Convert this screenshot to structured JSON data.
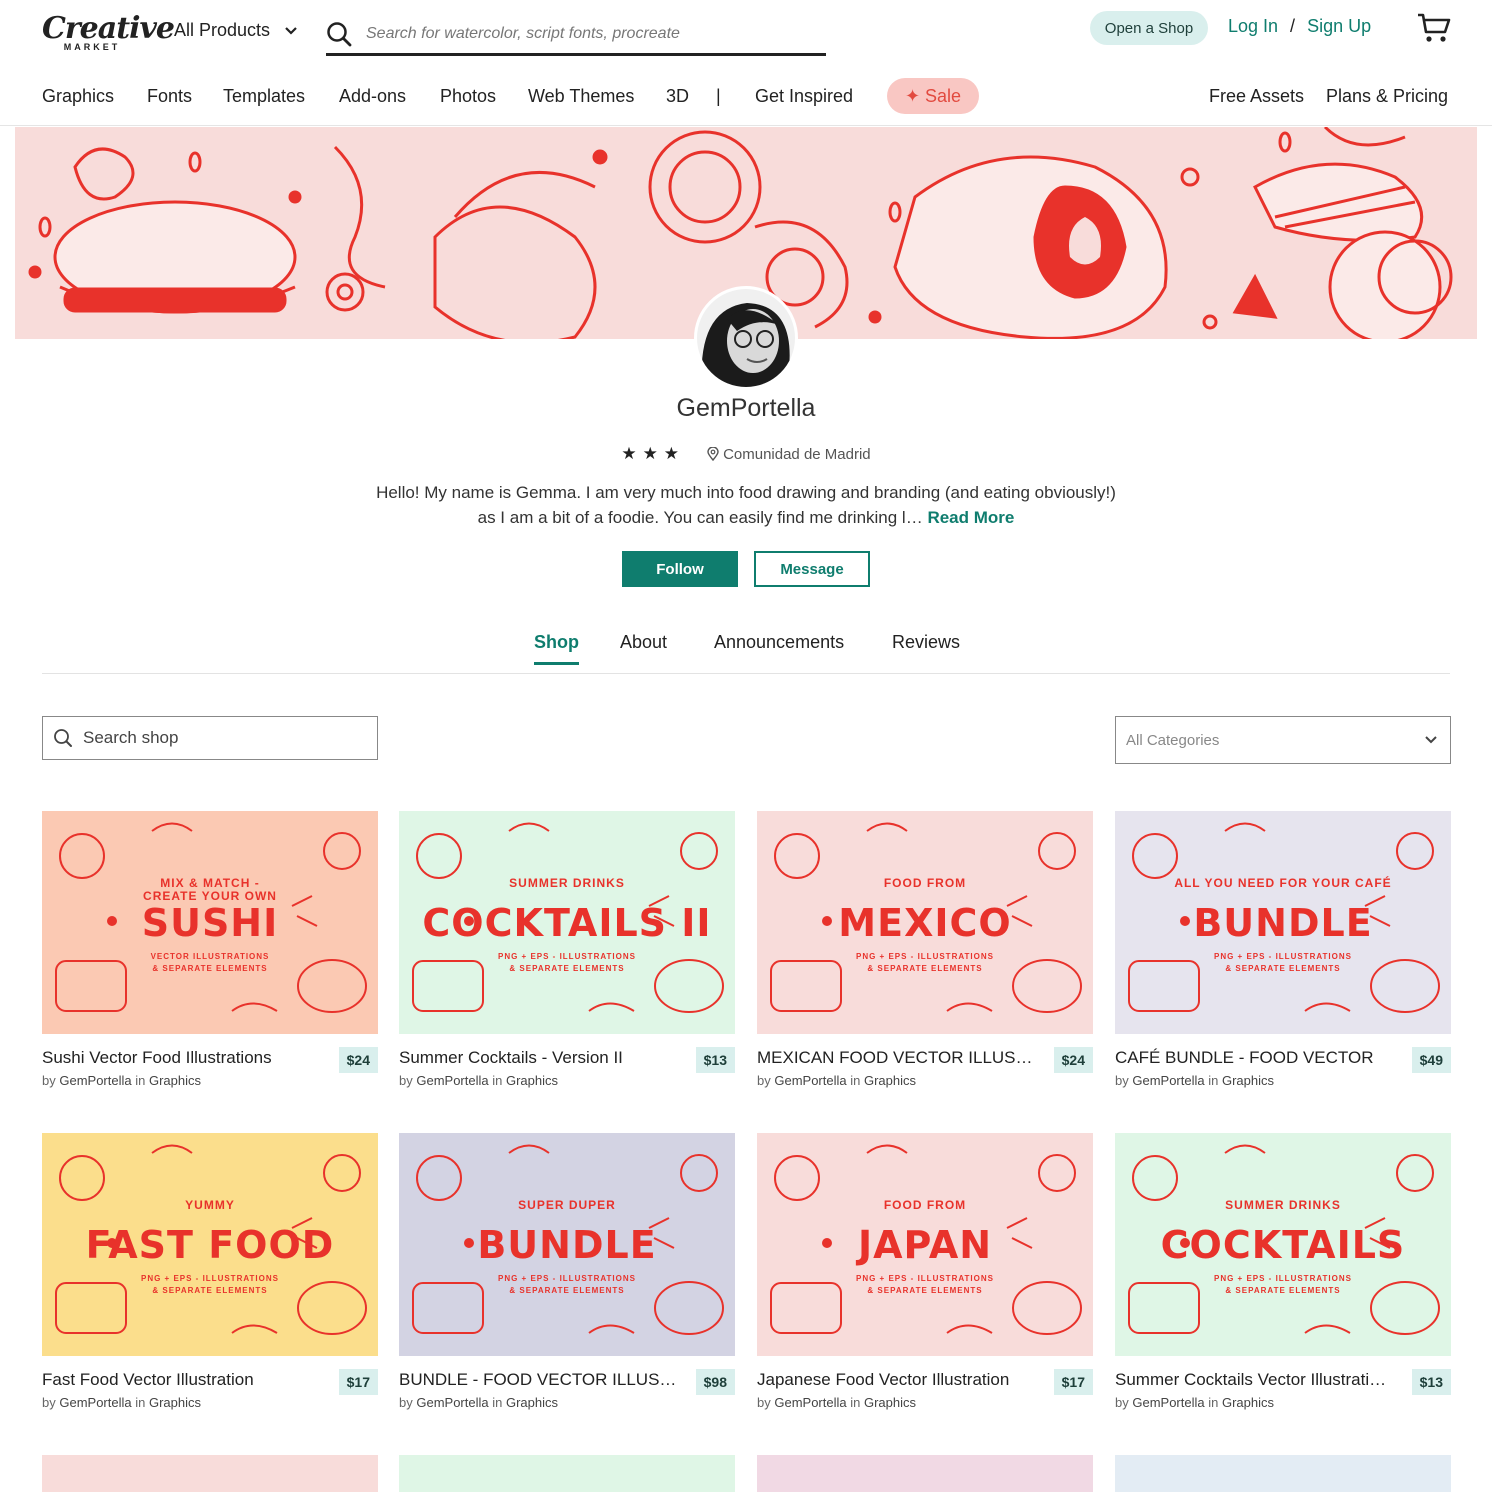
{
  "header": {
    "logo_word": "Creative",
    "logo_sub": "MARKET",
    "product_select": "All Products",
    "search_placeholder": "Search for watercolor, script fonts, procreate",
    "open_shop": "Open a Shop",
    "login": "Log In",
    "auth_sep": "/",
    "signup": "Sign Up"
  },
  "nav": {
    "items": [
      "Graphics",
      "Fonts",
      "Templates",
      "Add-ons",
      "Photos",
      "Web Themes",
      "3D",
      "|",
      "Get Inspired"
    ],
    "sale": "✦ Sale",
    "right": [
      "Free Assets",
      "Plans & Pricing"
    ]
  },
  "colors": {
    "accent": "#0f7d6e",
    "sale_bg": "#f9c7c3",
    "illustration_red": "#e8322b",
    "banner_bg": "#f8dcda"
  },
  "profile": {
    "name": "GemPortella",
    "stars": "★★★",
    "location": "Comunidad de Madrid",
    "bio": "Hello! My name is Gemma. I am very much into food drawing and branding (and eating obviously!) as I am a bit of a foodie. You can easily find me drinking l…",
    "read_more": "Read More",
    "follow": "Follow",
    "message": "Message"
  },
  "tabs": [
    "Shop",
    "About",
    "Announcements",
    "Reviews"
  ],
  "shop_search_placeholder": "Search shop",
  "category_select": "All Categories",
  "products": [
    {
      "title": "Sushi Vector Food Illustrations",
      "price": "$24",
      "author": "GemPortella",
      "category": "Graphics",
      "bg": "#fbc9b3",
      "art": {
        "top": "MIX & MATCH -\nCREATE YOUR OWN",
        "main": "SUSHI",
        "sub": "VECTOR ILLUSTRATIONS\n& SEPARATE ELEMENTS"
      }
    },
    {
      "title": "Summer Cocktails - Version II",
      "price": "$13",
      "author": "GemPortella",
      "category": "Graphics",
      "bg": "#dff6e6",
      "art": {
        "top": "SUMMER DRINKS",
        "main": "COCKTAILS II",
        "sub": "PNG + EPS - ILLUSTRATIONS\n& SEPARATE ELEMENTS"
      }
    },
    {
      "title": "MEXICAN FOOD VECTOR ILLUSTRATIONS",
      "price": "$24",
      "author": "GemPortella",
      "category": "Graphics",
      "bg": "#f8dcda",
      "art": {
        "top": "FOOD FROM",
        "main": "MEXICO",
        "sub": "PNG + EPS - ILLUSTRATIONS\n& SEPARATE ELEMENTS"
      }
    },
    {
      "title": "CAFÉ BUNDLE - FOOD VECTOR",
      "price": "$49",
      "author": "GemPortella",
      "category": "Graphics",
      "bg": "#e6e4ee",
      "art": {
        "top": "ALL YOU NEED FOR YOUR CAFÉ",
        "main": "BUNDLE",
        "sub": "PNG + EPS - ILLUSTRATIONS\n& SEPARATE ELEMENTS"
      }
    },
    {
      "title": "Fast Food Vector Illustration",
      "price": "$17",
      "author": "GemPortella",
      "category": "Graphics",
      "bg": "#fbde8c",
      "art": {
        "top": "YUMMY",
        "main": "FAST FOOD",
        "sub": "PNG + EPS - ILLUSTRATIONS\n& SEPARATE ELEMENTS"
      }
    },
    {
      "title": "BUNDLE - FOOD VECTOR ILLUSTRATIONS",
      "price": "$98",
      "author": "GemPortella",
      "category": "Graphics",
      "bg": "#d3d3e3",
      "art": {
        "top": "SUPER DUPER",
        "main": "BUNDLE",
        "sub": "PNG + EPS - ILLUSTRATIONS\n& SEPARATE ELEMENTS"
      }
    },
    {
      "title": "Japanese Food Vector Illustration",
      "price": "$17",
      "author": "GemPortella",
      "category": "Graphics",
      "bg": "#f8dcda",
      "art": {
        "top": "FOOD FROM",
        "main": "JAPAN",
        "sub": "PNG + EPS - ILLUSTRATIONS\n& SEPARATE ELEMENTS"
      }
    },
    {
      "title": "Summer Cocktails Vector Illustrations",
      "price": "$13",
      "author": "GemPortella",
      "category": "Graphics",
      "bg": "#dff6e6",
      "art": {
        "top": "SUMMER DRINKS",
        "main": "COCKTAILS",
        "sub": "PNG + EPS - ILLUSTRATIONS\n& SEPARATE ELEMENTS"
      }
    }
  ],
  "by_label": "by",
  "in_label": "in",
  "peek_colors": [
    "#f8dcda",
    "#dff6e6",
    "#f1d9e4",
    "#e3ecf4"
  ]
}
